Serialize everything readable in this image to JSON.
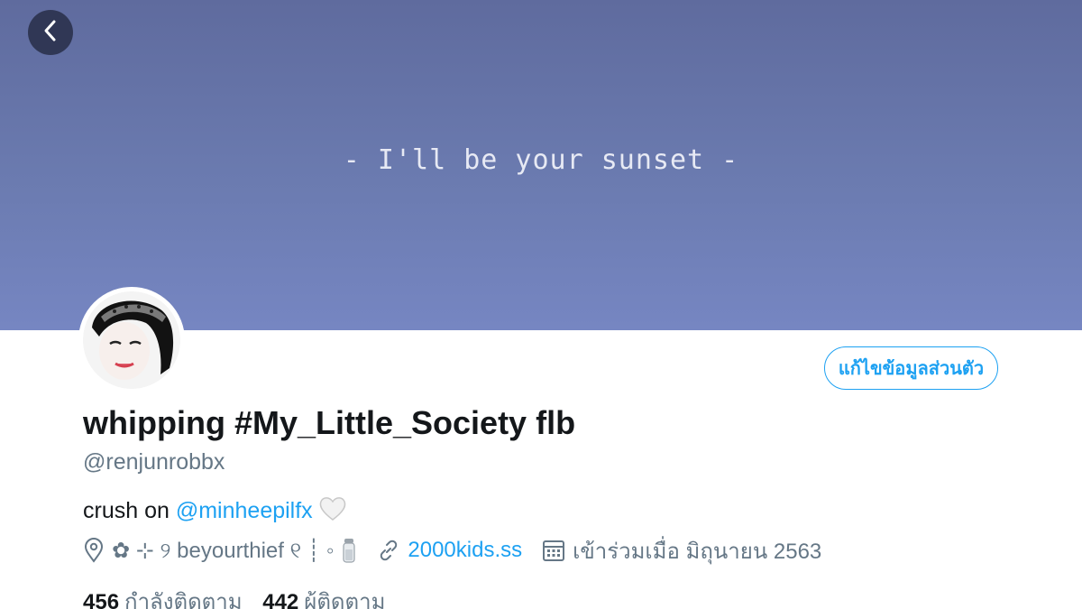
{
  "banner": {
    "text": "- I'll be your sunset -",
    "gradient_top": "#5f6b9e",
    "gradient_bottom": "#7686c2"
  },
  "back_icon": "chevron-left-icon",
  "profile": {
    "edit_label": "แก้ไขข้อมูลส่วนตัว",
    "display_name": "whipping #My_Little_Society flb",
    "handle": "@renjunrobbx",
    "bio_prefix": "crush on ",
    "bio_mention": "@minheepilfx",
    "bio_emoji": "white-heart-icon",
    "location": "✿ ⊹ ୨ beyourthief ୧ ┊ ◦",
    "website": "2000kids.ss",
    "joined": "เข้าร่วมเมื่อ มิถุนายน 2563",
    "following_count": "456",
    "following_label": "กำลังติดตาม",
    "followers_count": "442",
    "followers_label": "ผู้ติดตาม"
  },
  "colors": {
    "accent": "#1da1f2",
    "muted": "#657786",
    "text": "#14171a"
  }
}
